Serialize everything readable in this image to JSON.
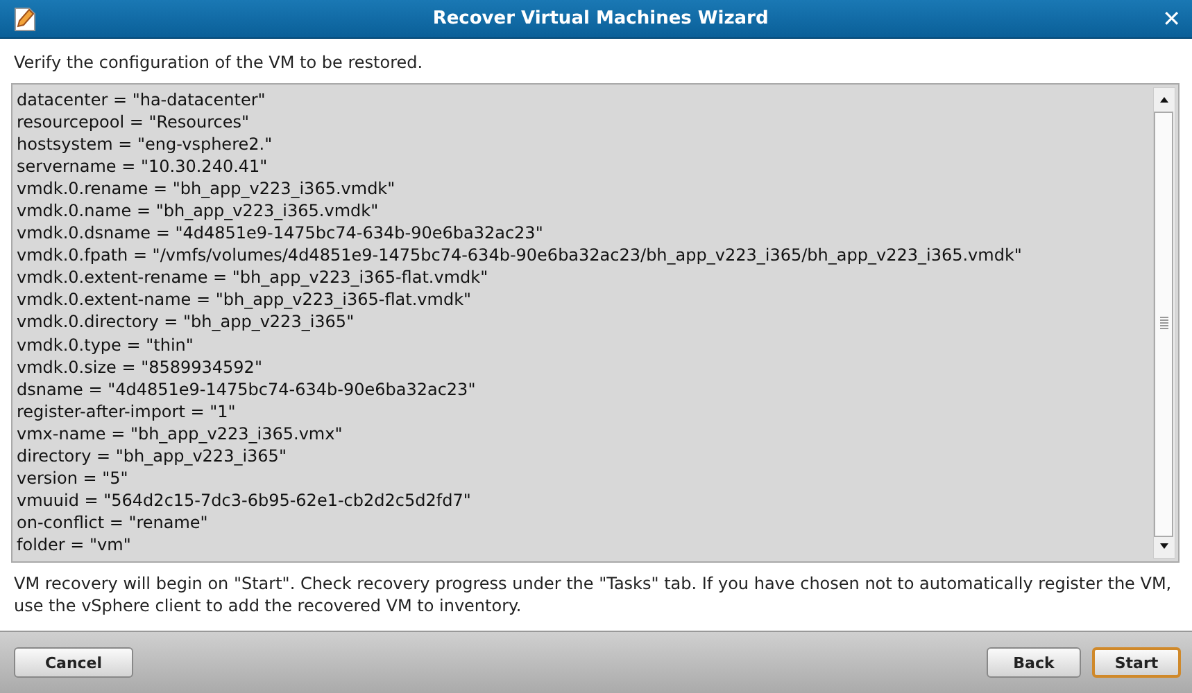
{
  "window": {
    "title": "Recover Virtual Machines Wizard",
    "close": "✕"
  },
  "instruction": "Verify the configuration of the VM to be restored.",
  "config_lines": [
    "datacenter = \"ha-datacenter\"",
    "resourcepool = \"Resources\"",
    "hostsystem = \"eng-vsphere2.\"",
    "servername = \"10.30.240.41\"",
    "vmdk.0.rename = \"bh_app_v223_i365.vmdk\"",
    "vmdk.0.name = \"bh_app_v223_i365.vmdk\"",
    "vmdk.0.dsname = \"4d4851e9-1475bc74-634b-90e6ba32ac23\"",
    "vmdk.0.fpath = \"/vmfs/volumes/4d4851e9-1475bc74-634b-90e6ba32ac23/bh_app_v223_i365/bh_app_v223_i365.vmdk\"",
    "vmdk.0.extent-rename = \"bh_app_v223_i365-flat.vmdk\"",
    "vmdk.0.extent-name = \"bh_app_v223_i365-flat.vmdk\"",
    "vmdk.0.directory = \"bh_app_v223_i365\"",
    "vmdk.0.type = \"thin\"",
    "vmdk.0.size = \"8589934592\"",
    "dsname = \"4d4851e9-1475bc74-634b-90e6ba32ac23\"",
    "register-after-import = \"1\"",
    "vmx-name = \"bh_app_v223_i365.vmx\"",
    "directory = \"bh_app_v223_i365\"",
    "version = \"5\"",
    "vmuuid = \"564d2c15-7dc3-6b95-62e1-cb2d2c5d2fd7\"",
    "on-conflict = \"rename\"",
    "folder = \"vm\""
  ],
  "note": "VM recovery will begin on \"Start\". Check recovery progress under the \"Tasks\" tab. If you have chosen not to automatically register the VM, use the vSphere client to add the recovered VM to inventory.",
  "buttons": [
    {
      "kind": "left",
      "label": "Cancel",
      "default": false
    },
    {
      "kind": "right",
      "label": "Back",
      "default": false
    },
    {
      "kind": "right",
      "label": "Start",
      "default": true
    }
  ]
}
